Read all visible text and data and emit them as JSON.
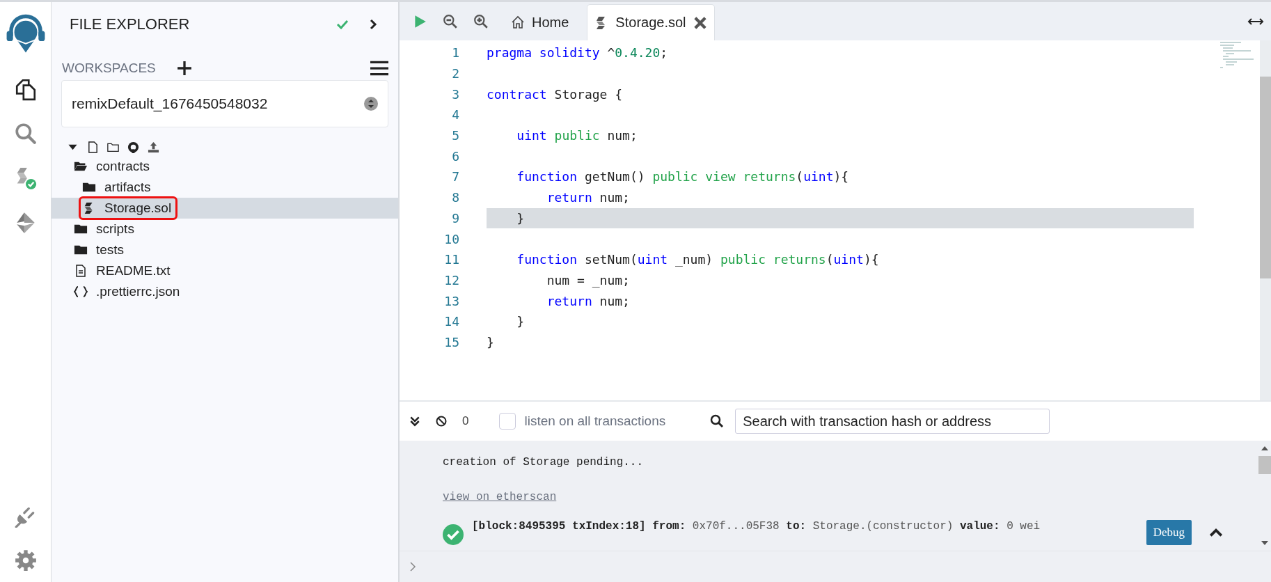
{
  "explorer": {
    "title": "FILE EXPLORER",
    "workspaces_label": "WORKSPACES",
    "workspace": "remixDefault_1676450548032",
    "tree": [
      {
        "label": "contracts",
        "kind": "folder",
        "expanded": true,
        "selected": false,
        "children": [
          {
            "label": "artifacts",
            "kind": "folder",
            "expanded": false,
            "selected": false
          },
          {
            "label": "Storage.sol",
            "kind": "sol",
            "selected": true
          }
        ]
      },
      {
        "label": "scripts",
        "kind": "folder",
        "expanded": false,
        "selected": false
      },
      {
        "label": "tests",
        "kind": "folder",
        "expanded": false,
        "selected": false
      },
      {
        "label": "README.txt",
        "kind": "txt",
        "selected": false
      },
      {
        "label": ".prettierrc.json",
        "kind": "json",
        "selected": false
      }
    ]
  },
  "editor": {
    "tabs": [
      {
        "label": "Home",
        "kind": "home",
        "selected": false
      },
      {
        "label": "Storage.sol",
        "kind": "sol",
        "selected": true
      }
    ],
    "lines": [
      {
        "number": "1",
        "selected": false,
        "tokens": [
          {
            "text": "pragma solidity",
            "kind": "keyword"
          },
          {
            "text": " ^",
            "kind": "plain"
          },
          {
            "text": "0.4.20",
            "kind": "number"
          },
          {
            "text": ";",
            "kind": "plain"
          }
        ]
      },
      {
        "number": "2",
        "selected": false
      },
      {
        "number": "3",
        "selected": false,
        "tokens": [
          {
            "text": "contract",
            "kind": "keyword"
          },
          {
            "text": " Storage {",
            "kind": "plain"
          }
        ]
      },
      {
        "number": "4",
        "selected": false
      },
      {
        "number": "5",
        "selected": false,
        "tokens": [
          {
            "text": "    uint",
            "kind": "keyword"
          },
          {
            "text": " public",
            "kind": "modifier"
          },
          {
            "text": " num;",
            "kind": "plain"
          }
        ]
      },
      {
        "number": "6",
        "selected": false
      },
      {
        "number": "7",
        "selected": false,
        "tokens": [
          {
            "text": "    function",
            "kind": "keyword"
          },
          {
            "text": " getNum() ",
            "kind": "plain"
          },
          {
            "text": "public view returns",
            "kind": "modifier"
          },
          {
            "text": "(",
            "kind": "plain"
          },
          {
            "text": "uint",
            "kind": "keyword"
          },
          {
            "text": "){",
            "kind": "plain"
          }
        ]
      },
      {
        "number": "8",
        "selected": false,
        "tokens": [
          {
            "text": "        return",
            "kind": "keyword"
          },
          {
            "text": " num;",
            "kind": "plain"
          }
        ]
      },
      {
        "number": "9",
        "selected": true,
        "tokens": [
          {
            "text": "    }",
            "kind": "plain"
          }
        ]
      },
      {
        "number": "10",
        "selected": false
      },
      {
        "number": "11",
        "selected": false,
        "tokens": [
          {
            "text": "    function",
            "kind": "keyword"
          },
          {
            "text": " setNum(",
            "kind": "plain"
          },
          {
            "text": "uint",
            "kind": "keyword"
          },
          {
            "text": " _num) ",
            "kind": "plain"
          },
          {
            "text": "public returns",
            "kind": "modifier"
          },
          {
            "text": "(",
            "kind": "plain"
          },
          {
            "text": "uint",
            "kind": "keyword"
          },
          {
            "text": "){",
            "kind": "plain"
          }
        ]
      },
      {
        "number": "12",
        "selected": false,
        "tokens": [
          {
            "text": "        num = _num;",
            "kind": "plain"
          }
        ]
      },
      {
        "number": "13",
        "selected": false,
        "tokens": [
          {
            "text": "        return",
            "kind": "keyword"
          },
          {
            "text": " num;",
            "kind": "plain"
          }
        ]
      },
      {
        "number": "14",
        "selected": false,
        "tokens": [
          {
            "text": "    }",
            "kind": "plain"
          }
        ]
      },
      {
        "number": "15",
        "selected": false,
        "tokens": [
          {
            "text": "}",
            "kind": "plain"
          }
        ]
      }
    ]
  },
  "terminal": {
    "count": "0",
    "listen": {
      "label": "listen on all transactions",
      "checked": false
    },
    "search": {
      "placeholder": "Search with transaction hash or address"
    },
    "log": [
      {
        "kind": "text",
        "text": "creation of Storage pending..."
      },
      {
        "kind": "link",
        "text": "view on etherscan"
      },
      {
        "kind": "tx",
        "text": "**[block:8495395 txIndex:18]  from:** 0x70f...05F38 **to:** Storage.(constructor) **value:** 0 wei",
        "button": "Debug"
      }
    ]
  }
}
